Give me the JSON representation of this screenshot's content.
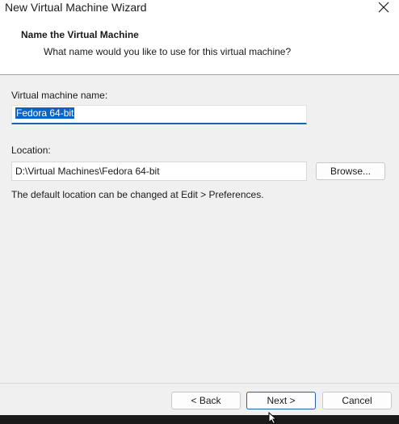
{
  "window": {
    "title": "New Virtual Machine Wizard"
  },
  "header": {
    "title": "Name the Virtual Machine",
    "subtitle": "What name would you like to use for this virtual machine?"
  },
  "form": {
    "name_label": "Virtual machine name:",
    "name_value": "Fedora 64-bit",
    "location_label": "Location:",
    "location_value": "D:\\Virtual Machines\\Fedora 64-bit",
    "browse_label": "Browse...",
    "hint": "The default location can be changed at Edit > Preferences."
  },
  "footer": {
    "back_label": "< Back",
    "next_label": "Next >",
    "cancel_label": "Cancel"
  },
  "colors": {
    "accent": "#1f5fb4",
    "selection": "#0a64c8"
  },
  "icons": {
    "close": "close-icon",
    "cursor": "mouse-cursor-icon"
  }
}
